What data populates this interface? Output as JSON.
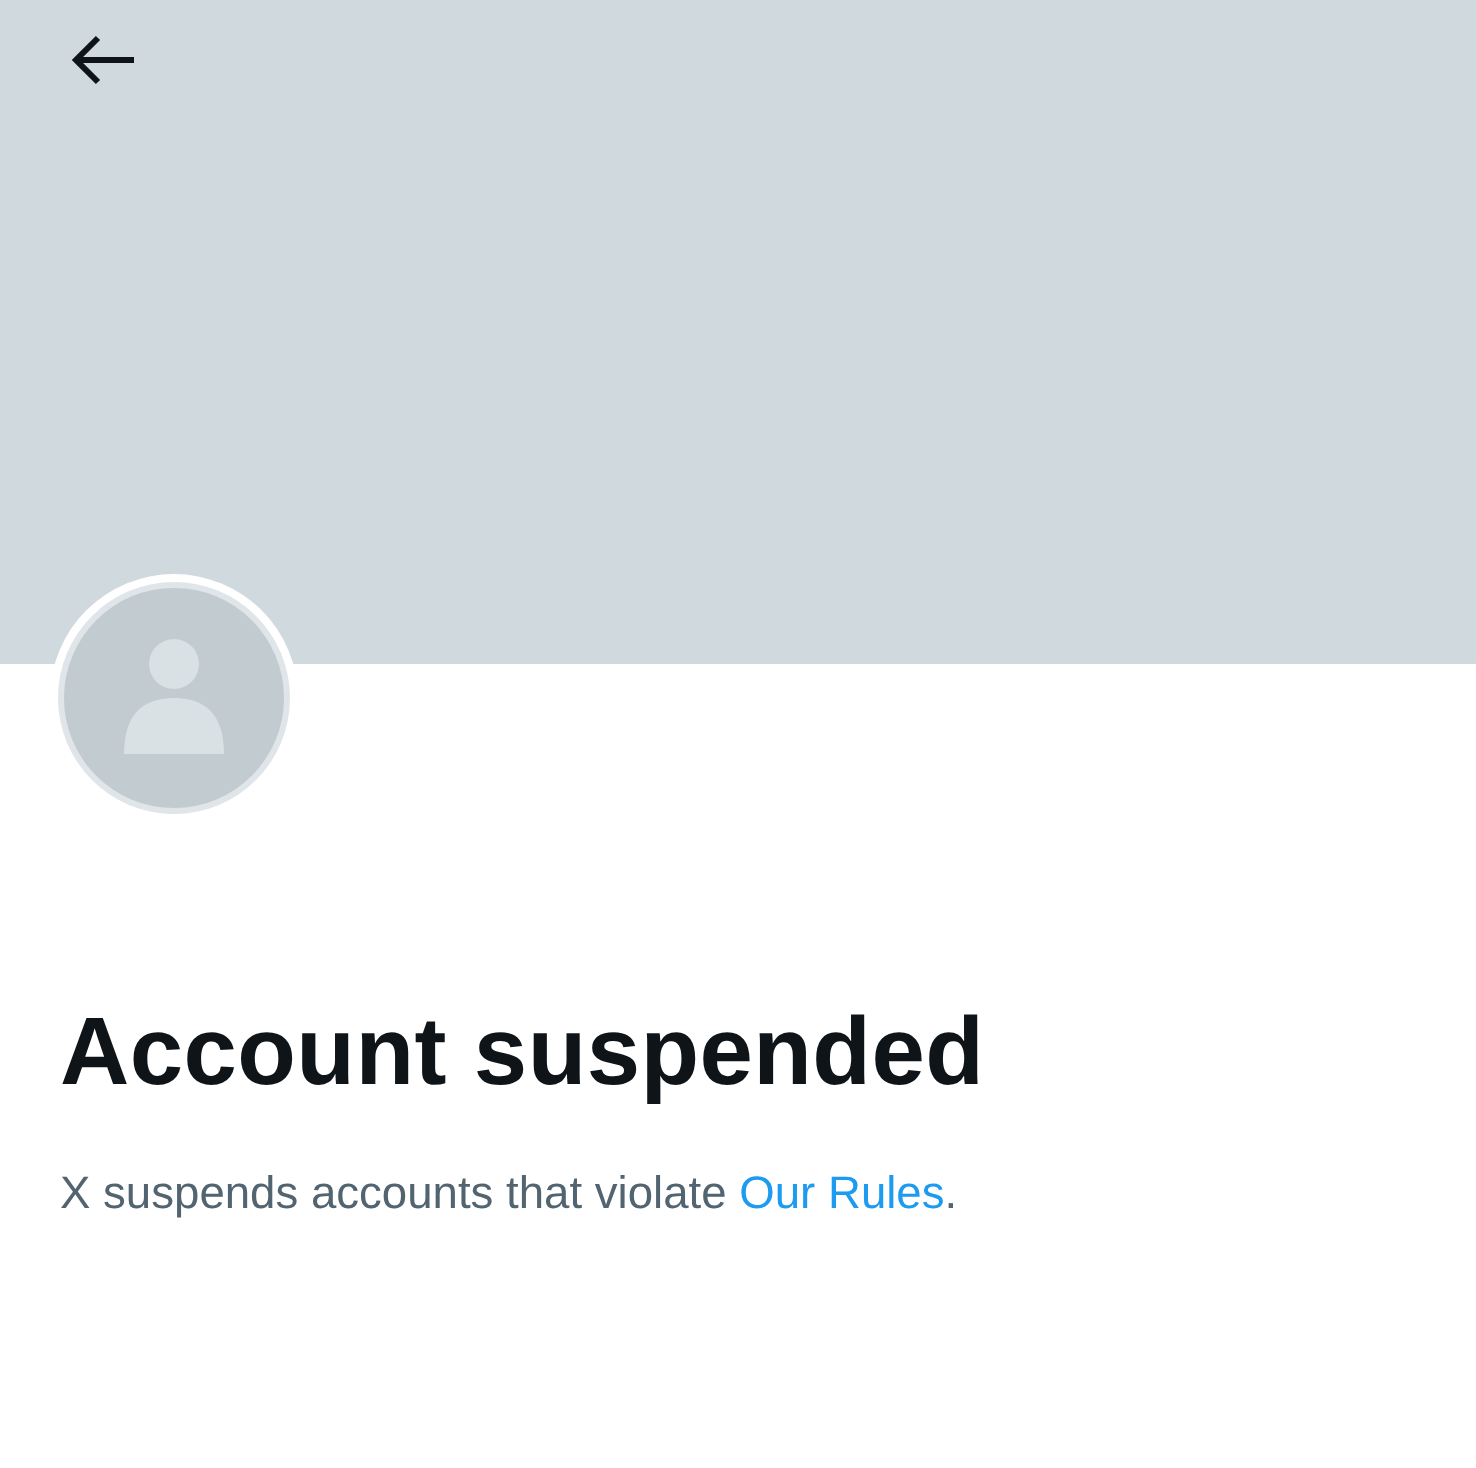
{
  "header": {
    "banner": true
  },
  "profile": {
    "title": "Account suspended",
    "message": {
      "text_before": "X suspends accounts that violate ",
      "link": "Our Rules",
      "text_after": "."
    }
  }
}
